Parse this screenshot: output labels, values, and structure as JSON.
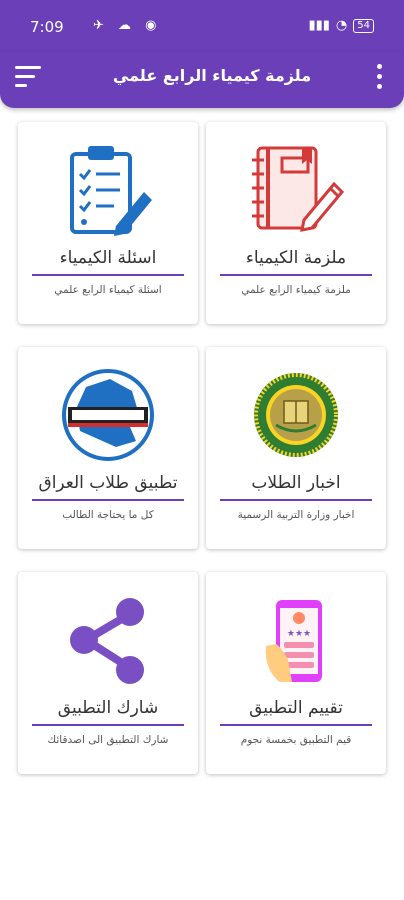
{
  "status_bar": {
    "time": "7:09",
    "battery": "54"
  },
  "app_bar": {
    "title": "ملزمة كيمياء الرابع علمي"
  },
  "cards": [
    {
      "title": "ملزمة الكيمياء",
      "subtitle": "ملزمة كيمياء الرابع علمي",
      "icon": "notebook-pencil-icon",
      "accent": "#d43a3a"
    },
    {
      "title": "اسئلة الكيمياء",
      "subtitle": "اسئلة كيمياء الرابع علمي",
      "icon": "clipboard-checklist-icon",
      "accent": "#1f6fc2"
    },
    {
      "title": "اخبار الطلاب",
      "subtitle": "اخبار وزارة التربية الرسمية",
      "icon": "ministry-seal-icon",
      "accent": "#2e7d32"
    },
    {
      "title": "تطبيق طلاب العراق",
      "subtitle": "كل ما يحتاجة الطالب",
      "icon": "iraq-map-logo-icon",
      "accent": "#1f6fc2"
    },
    {
      "title": "تقييم التطبيق",
      "subtitle": "قيم التطبيق بخمسة نجوم",
      "icon": "phone-rating-icon",
      "accent": "#e040fb"
    },
    {
      "title": "شارك التطبيق",
      "subtitle": "شارك التطبيق الى اصدقائك",
      "icon": "share-icon",
      "accent": "#7b4fc4"
    }
  ],
  "colors": {
    "primary": "#6a3fb8"
  }
}
